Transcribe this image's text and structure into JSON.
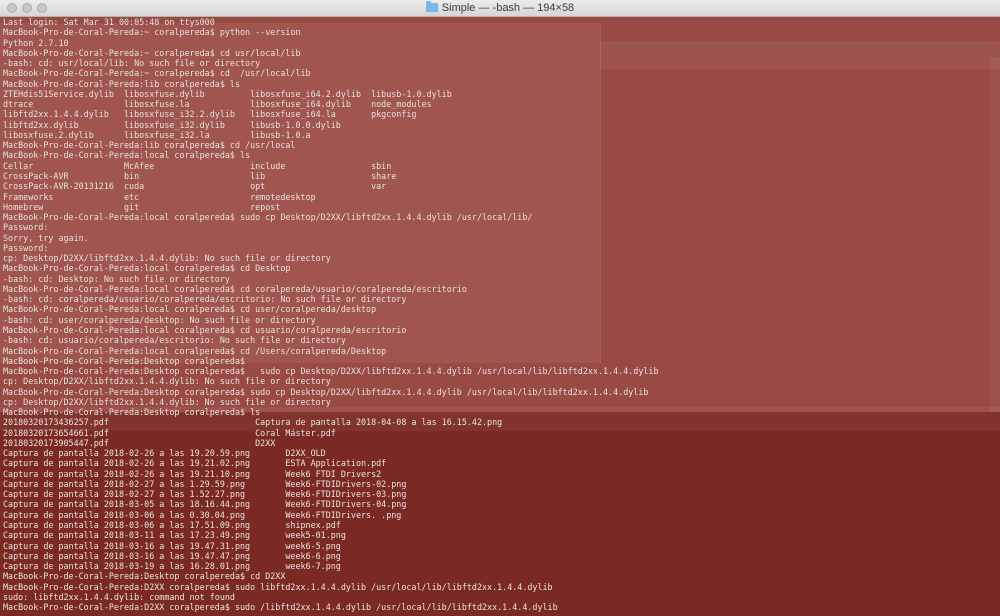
{
  "window": {
    "title": "Simple — -bash — 194×58",
    "folder_icon": "folder-icon"
  },
  "colors": {
    "background": "#93413a",
    "text": "#f0e6e3",
    "titlebar": "#e4e4e4"
  },
  "terminal": {
    "lines": [
      "Last login: Sat Mar 31 00:05:48 on ttys000",
      "MacBook-Pro-de-Coral-Pereda:~ coralpereda$ python --version",
      "Python 2.7.10",
      "MacBook-Pro-de-Coral-Pereda:~ coralpereda$ cd usr/local/lib",
      "-bash: cd: usr/local/lib: No such file or directory",
      "MacBook-Pro-de-Coral-Pereda:~ coralpereda$ cd  /usr/local/lib",
      "MacBook-Pro-de-Coral-Pereda:lib coralpereda$ ls",
      "ZTEHdis51Service.dylib  libosxfuse.dylib         libosxfuse_i64.2.dylib  libusb-1.0.dylib",
      "dtrace                  libosxfuse.la            libosxfuse_i64.dylib    node_modules",
      "libftd2xx.1.4.4.dylib   libosxfuse_i32.2.dylib   libosxfuse_i64.la       pkgconfig",
      "libftd2xx.dylib         libosxfuse_i32.dylib     libusb-1.0.0.dylib",
      "libosxfuse.2.dylib      libosxfuse_i32.la        libusb-1.0.a",
      "MacBook-Pro-de-Coral-Pereda:lib coralpereda$ cd /usr/local",
      "MacBook-Pro-de-Coral-Pereda:local coralpereda$ ls",
      "Cellar                  McAfee                   include                 sbin",
      "CrossPack-AVR           bin                      lib                     share",
      "CrossPack-AVR-20131216  cuda                     opt                     var",
      "Frameworks              etc                      remotedesktop",
      "Homebrew                git                      repost",
      "MacBook-Pro-de-Coral-Pereda:local coralpereda$ sudo cp Desktop/D2XX/libftd2xx.1.4.4.dylib /usr/local/lib/",
      "Password:",
      "Sorry, try again.",
      "Password:",
      "cp: Desktop/D2XX/libftd2xx.1.4.4.dylib: No such file or directory",
      "MacBook-Pro-de-Coral-Pereda:local coralpereda$ cd Desktop",
      "-bash: cd: Desktop: No such file or directory",
      "MacBook-Pro-de-Coral-Pereda:local coralpereda$ cd coralpereda/usuario/coralpereda/escritorio",
      "-bash: cd: coralpereda/usuario/coralpereda/escritorio: No such file or directory",
      "MacBook-Pro-de-Coral-Pereda:local coralpereda$ cd user/coralpereda/desktop",
      "-bash: cd: user/coralpereda/desktop: No such file or directory",
      "MacBook-Pro-de-Coral-Pereda:local coralpereda$ cd usuario/coralpereda/escritorio",
      "-bash: cd: usuario/coralpereda/escritorio: No such file or directory",
      "MacBook-Pro-de-Coral-Pereda:local coralpereda$ cd /Users/coralpereda/Desktop",
      "MacBook-Pro-de-Coral-Pereda:Desktop coralpereda$",
      "MacBook-Pro-de-Coral-Pereda:Desktop coralpereda$   sudo cp Desktop/D2XX/libftd2xx.1.4.4.dylib /usr/local/lib/libftd2xx.1.4.4.dylib",
      "cp: Desktop/D2XX/libftd2xx.1.4.4.dylib: No such file or directory",
      "MacBook-Pro-de-Coral-Pereda:Desktop coralpereda$ sudo cp Desktop/D2XX/libftd2xx.1.4.4.dylib /usr/local/lib/libftd2xx.1.4.4.dylib",
      "cp: Desktop/D2XX/libftd2xx.1.4.4.dylib: No such file or directory",
      "MacBook-Pro-de-Coral-Pereda:Desktop coralpereda$ ls",
      "20180320173436257.pdf                             Captura de pantalla 2018-04-08 a las 16.15.42.png",
      "20180320173654661.pdf                             Coral Máster.pdf",
      "20180320173905447.pdf                             D2XX",
      "Captura de pantalla 2018-02-26 a las 19.20.59.png       D2XX_OLD",
      "Captura de pantalla 2018-02-26 a las 19.21.02.png       ESTA Application.pdf",
      "Captura de pantalla 2018-02-26 a las 19.21.10.png       Week6 FTDI Drivers2",
      "Captura de pantalla 2018-02-27 a las 1.29.59.png        Week6-FTDIDrivers-02.png",
      "Captura de pantalla 2018-02-27 a las 1.52.27.png        Week6-FTDIDrivers-03.png",
      "Captura de pantalla 2018-03-05 a las 18.16.44.png       Week6-FTDIDrivers-04.png",
      "Captura de pantalla 2018-03-06 a las 0.30.04.png        Week6-FTDIDrivers. .png",
      "Captura de pantalla 2018-03-06 a las 17.51.09.png       shipnex.pdf",
      "Captura de pantalla 2018-03-11 a las 17.23.49.png       week5-01.png",
      "Captura de pantalla 2018-03-16 a las 19.47.31.png       week6-5.png",
      "Captura de pantalla 2018-03-16 a las 19.47.47.png       week6-6.png",
      "Captura de pantalla 2018-03-19 a las 16.28.01.png       week6-7.png",
      "MacBook-Pro-de-Coral-Pereda:Desktop coralpereda$ cd D2XX",
      "MacBook-Pro-de-Coral-Pereda:D2XX coralpereda$ sudo libftd2xx.1.4.4.dylib /usr/local/lib/libftd2xx.1.4.4.dylib",
      "sudo: libftd2xx.1.4.4.dylib: command not found",
      "MacBook-Pro-de-Coral-Pereda:D2XX coralpereda$ sudo /libftd2xx.1.4.4.dylib /usr/local/lib/libftd2xx.1.4.4.dylib"
    ]
  }
}
